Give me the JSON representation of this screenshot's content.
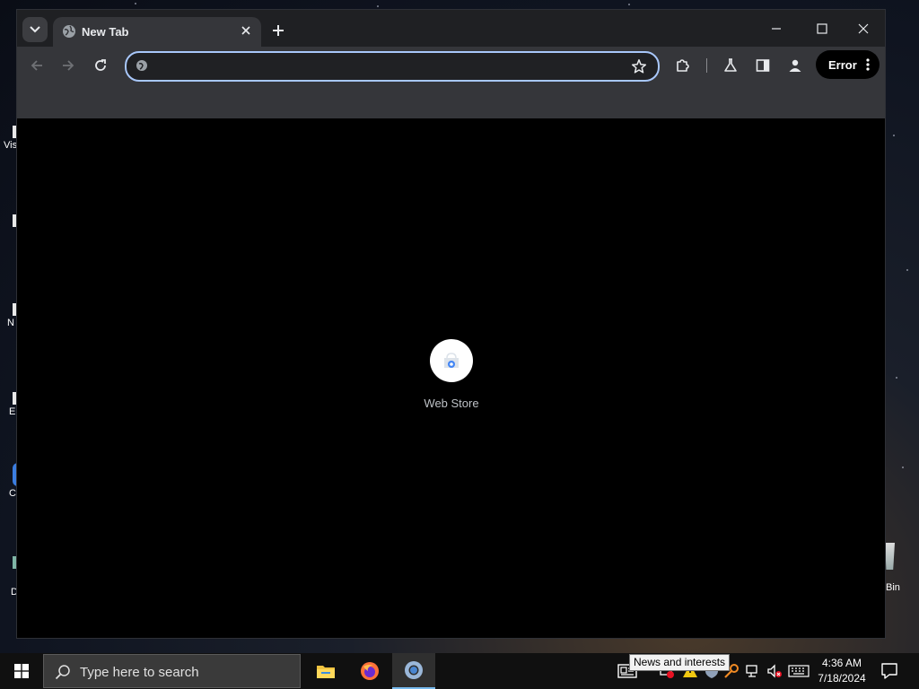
{
  "browser": {
    "tab": {
      "title": "New Tab"
    },
    "omnibox": {
      "value": "",
      "placeholder": ""
    },
    "profile": {
      "status_label": "Error"
    },
    "shortcuts": [
      {
        "label": "Web Store"
      }
    ]
  },
  "desktop": {
    "icons": [
      {
        "label": "Vis"
      },
      {
        "label": ""
      },
      {
        "label": "N"
      },
      {
        "label": "E"
      },
      {
        "label": "C"
      },
      {
        "label": "D"
      }
    ],
    "recycle_bin_label": "Bin"
  },
  "taskbar": {
    "search_placeholder": "Type here to search",
    "apps": [
      "file-explorer",
      "firefox",
      "chrome"
    ],
    "tooltip": "News and interests",
    "time": "4:36 AM",
    "date": "7/18/2024"
  },
  "colors": {
    "omnibox_focus": "#a8c7fa",
    "toolbar_bg": "#35363a",
    "tabstrip_bg": "#1f2023",
    "taskbar_bg": "#101010",
    "active_app_indicator": "#76b9ed"
  }
}
